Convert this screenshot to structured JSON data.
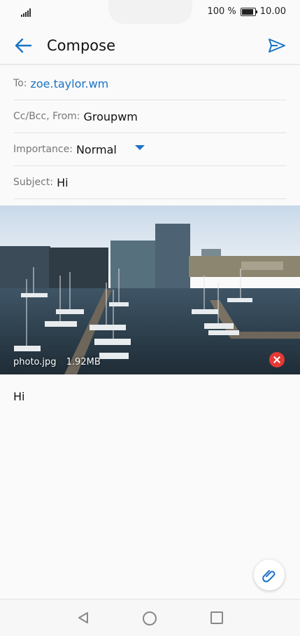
{
  "status_bar": {
    "battery_percent": "100 %",
    "time": "10.00",
    "battery_level": 1.0
  },
  "header": {
    "title": "Compose",
    "back_icon": "arrow-left-icon",
    "send_icon": "send-icon"
  },
  "fields": {
    "to_label": "To:",
    "to_value": "zoe.taylor.wm",
    "ccbcc_label": "Cc/Bcc, From:",
    "ccbcc_value": "Groupwm",
    "importance_label": "Importance:",
    "importance_value": "Normal",
    "subject_label": "Subject:",
    "subject_value": "Hi"
  },
  "attachment": {
    "filename": "photo.jpg",
    "size": "1.92MB",
    "remove_icon": "remove-icon"
  },
  "body": {
    "text": "Hi"
  },
  "fab": {
    "icon": "paperclip-icon"
  },
  "colors": {
    "accent": "#1a74c6",
    "remove": "#e53935",
    "background": "#fafafa"
  }
}
